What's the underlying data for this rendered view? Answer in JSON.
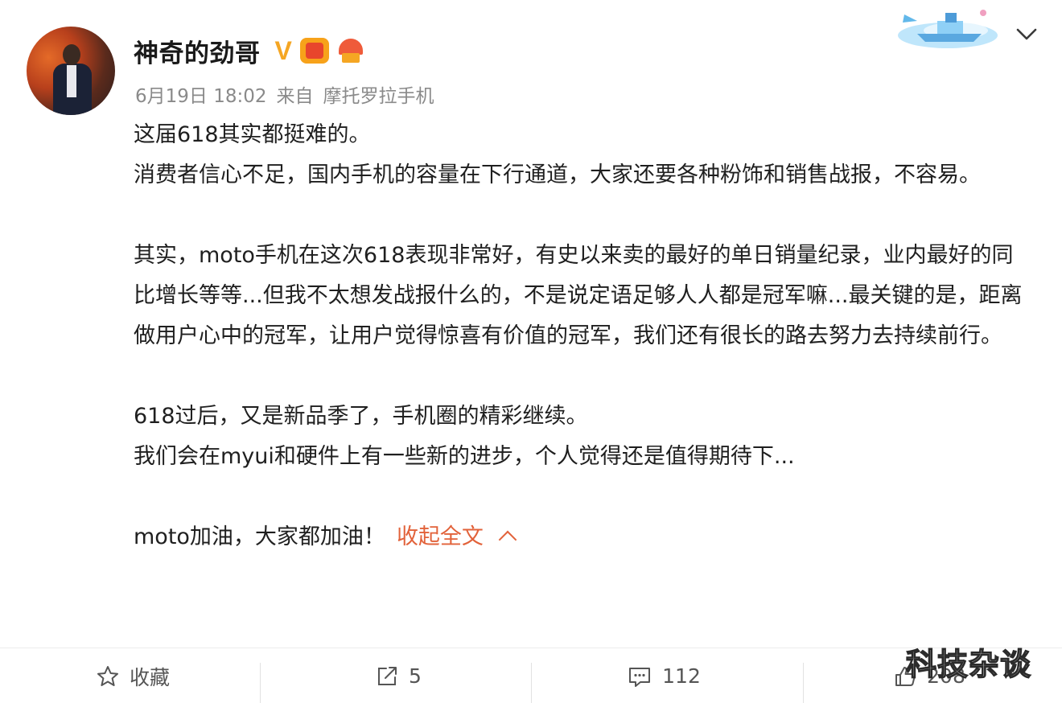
{
  "post": {
    "author": {
      "name": "神奇的劲哥",
      "verified_badge": "V",
      "badges": [
        "vip-crown-icon",
        "fan-badge-icon"
      ]
    },
    "meta": {
      "date": "6月19日 18:02",
      "source_prefix": "来自",
      "source": "摩托罗拉手机"
    },
    "content": {
      "lines": [
        "这届618其实都挺难的。",
        "消费者信心不足，国内手机的容量在下行通道，大家还要各种粉饰和销售战报，不容易。",
        "",
        "其实，moto手机在这次618表现非常好，有史以来卖的最好的单日销量纪录，业内最好的同比增长等等...但我不太想发战报什么的，不是说定语足够人人都是冠军嘛...最关键的是，距离做用户心中的冠军，让用户觉得惊喜有价值的冠军，我们还有很长的路去努力去持续前行。",
        "",
        "618过后，又是新品季了，手机圈的精彩继续。",
        "我们会在myui和硬件上有一些新的进步，个人觉得还是值得期待下...",
        ""
      ],
      "closing_line": "moto加油，大家都加油！",
      "collapse_label": "收起全文"
    },
    "actions": {
      "favorite_label": "收藏",
      "repost_count": "5",
      "comment_count": "112",
      "like_count": "208"
    },
    "watermark": "科技杂谈"
  },
  "colors": {
    "accent": "#e2623a",
    "verified": "#f5a623",
    "meta_text": "#8a8a8a",
    "body_text": "#1f1f1f"
  }
}
